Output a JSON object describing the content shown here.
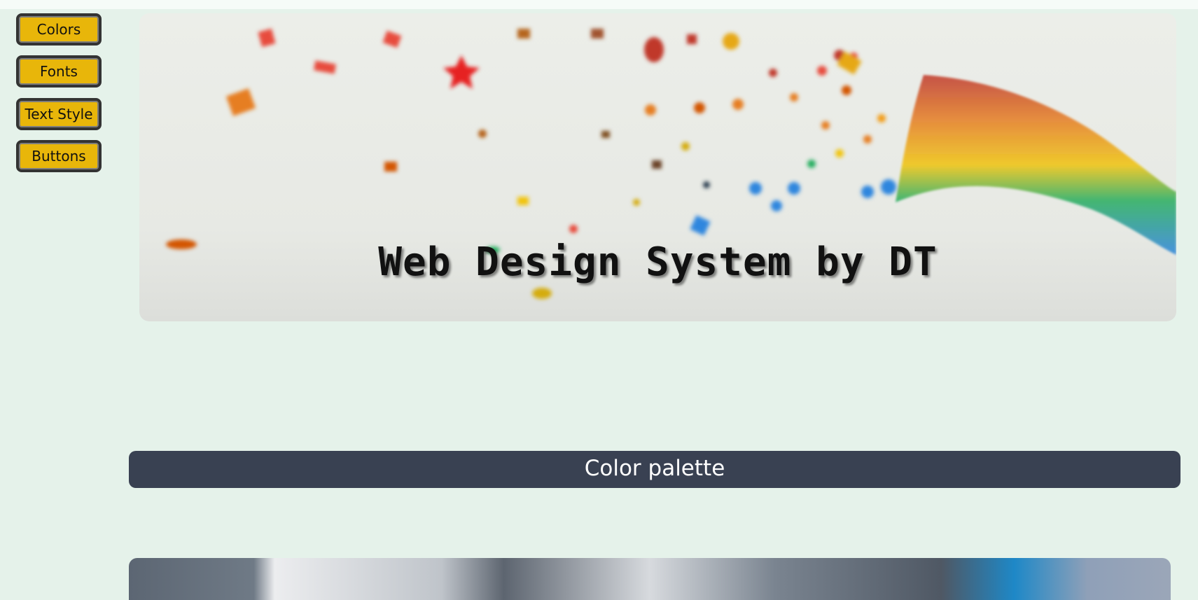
{
  "nav": {
    "items": [
      {
        "label": "Colors"
      },
      {
        "label": "Fonts"
      },
      {
        "label": "Text Style"
      },
      {
        "label": "Buttons"
      }
    ]
  },
  "hero": {
    "title": "Web Design System by DT"
  },
  "sections": {
    "color_palette_title": "Color palette"
  },
  "colors": {
    "background": "#e5f2ea",
    "nav_button": "#e8b60a",
    "nav_border": "#333333",
    "section_header": "#394152",
    "section_text": "#ffffff"
  }
}
